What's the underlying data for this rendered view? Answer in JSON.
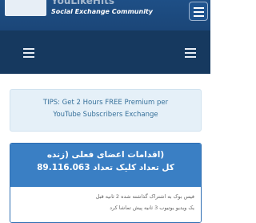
{
  "header": {
    "brand_name": "YouLikeHits",
    "tagline": "Social Exchange Community",
    "logo_icon": "site-logo",
    "menu_icon": "hamburger-icon"
  },
  "nav": {
    "left_icon": "hamburger-icon",
    "right_icon": "hamburger-icon"
  },
  "tips": {
    "line1": "TIPS: Get 2 Hours FREE Premium per",
    "line2": "YouTube Subscribers Exchange"
  },
  "stats": {
    "title_line1": "(اقدامات اعضای فعلی (زنده",
    "title_line2": "کل تعداد کلیک تعداد 89.116.063",
    "note_line1": "فیس بوک به اشتراک گذاشته شده 2 ثانیه قبل",
    "note_line2": "یک ویدیو یوتیوب 3 ثانیه پیش تماشا کرد"
  },
  "colors": {
    "header_bg": "#1e4f86",
    "nav_bg": "#16395f",
    "tips_bg": "#e5f0f8",
    "tips_text": "#36709a",
    "stats_head_bg": "#3a7fc4"
  }
}
